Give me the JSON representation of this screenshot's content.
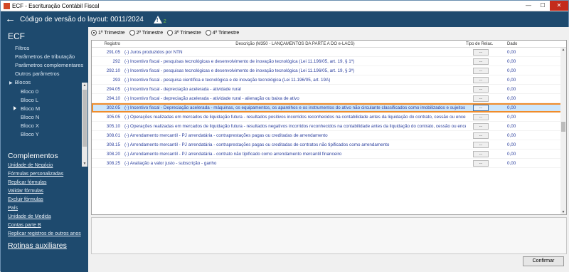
{
  "window": {
    "title": "ECF - Escrituração Contábil Fiscal"
  },
  "header": {
    "title": "Código de versão do layout: 0011/2024",
    "warning_count": "2"
  },
  "sidebar": {
    "title": "ECF",
    "items": [
      {
        "label": "Filtros"
      },
      {
        "label": "Parâmetros de tributação"
      },
      {
        "label": "Parâmetros complementares"
      },
      {
        "label": "Outros parâmetros"
      }
    ],
    "blocos_label": "Blocos",
    "blocos": [
      {
        "label": "Bloco 0"
      },
      {
        "label": "Bloco L"
      },
      {
        "label": "Bloco M"
      },
      {
        "label": "Bloco N"
      },
      {
        "label": "Bloco X"
      },
      {
        "label": "Bloco Y"
      }
    ],
    "complementos_title": "Complementos",
    "complementos": [
      {
        "label": "Unidade de Negócio"
      },
      {
        "label": "Fórmulas personalizadas"
      },
      {
        "label": "Replicar fórmulas"
      },
      {
        "label": "Validar fórmulas"
      },
      {
        "label": "Excluir fórmulas"
      },
      {
        "label": "País"
      },
      {
        "label": "Unidade de Medida"
      },
      {
        "label": "Contas parte B"
      },
      {
        "label": "Replicar registros de outros anos"
      }
    ],
    "rotinas_title": "Rotinas auxiliares"
  },
  "quarters": [
    {
      "label": "1º Trimestre",
      "selected": true
    },
    {
      "label": "2º Trimestre",
      "selected": false
    },
    {
      "label": "3º Trimestre",
      "selected": false
    },
    {
      "label": "4º Trimestre",
      "selected": false
    }
  ],
  "table": {
    "headers": {
      "registro": "Registro",
      "descricao": "Descrição (M350 - LANÇAMENTOS DA PARTE A DO e-LACS)",
      "tipo": "Tipo de Relac.",
      "dado": "Dado"
    },
    "button_label": "...",
    "rows": [
      {
        "registro": "291.05",
        "descricao": "(-) Juros produzidos por NTN",
        "dado": "0,00"
      },
      {
        "registro": "292",
        "descricao": "(-) Incentivo fiscal - pesquisas tecnológicas e desenvolvimento de inovação tecnológica (Lei 11.196/05, art. 19, § 1º)",
        "dado": "0,00"
      },
      {
        "registro": "292.10",
        "descricao": "(-) Incentivo fiscal - pesquisas tecnológicas e desenvolvimento de inovação tecnológica (Lei 11.196/05, art. 19, § 3º)",
        "dado": "0,00"
      },
      {
        "registro": "293",
        "descricao": "(-) Incentivo fiscal - pesquisa científica e tecnológica e de inovação tecnológica (Lei 11.196/05, art. 19A)",
        "dado": "0,00"
      },
      {
        "registro": "294.05",
        "descricao": "(-) Incentivo fiscal - depreciação acelerada - atividade rural",
        "dado": "0,00"
      },
      {
        "registro": "294.10",
        "descricao": "(-) Incentivo fiscal - depreciação acelerada - atividade rural - alienação ou baixa de ativo",
        "dado": "0,00"
      },
      {
        "registro": "302.05",
        "descricao": "(-) Incentivo fiscal - Depreciação acelerada - máquinas, os equipamentos, os aparelhos e os instrumentos do ativo não circulante classificados como imobilizados e sujeitos a desgaste pelo uso, p",
        "dado": "0,00",
        "selected": true
      },
      {
        "registro": "305.05",
        "descricao": "(-) Operações realizadas em mercados de liquidação futura - resultados positivos incorridos reconhecidos na contabilidade antes da liquidação do contrato, cessão ou encerramento da posição",
        "dado": "0,00"
      },
      {
        "registro": "305.10",
        "descricao": "(-) Operações realizadas em mercados de liquidação futura - resultados negativos incorridos reconhecidos na contabilidade antes da liquidação do contrato, cessão ou encerramento da posição",
        "dado": "0,00"
      },
      {
        "registro": "308.01",
        "descricao": "(-) Arrendamento mercantil - PJ arrendatária - contraprestações pagas ou creditadas de arrendamento",
        "dado": "0,00"
      },
      {
        "registro": "308.15",
        "descricao": "(-) Arrendamento mercantil - PJ arrendatária - contraprestações pagas ou creditadas de contratos não tipificados como arrendamento",
        "dado": "0,00"
      },
      {
        "registro": "308.20",
        "descricao": "(-) Arrendamento mercantil - PJ arrendatária - contrato não tipificado como arrendamento mercantil financeiro",
        "dado": "0,00"
      },
      {
        "registro": "308.25",
        "descricao": "(-) Avaliação a valor justo - subscrição - ganho",
        "dado": "0,00"
      }
    ]
  },
  "footer": {
    "confirm_label": "Confirmar"
  }
}
